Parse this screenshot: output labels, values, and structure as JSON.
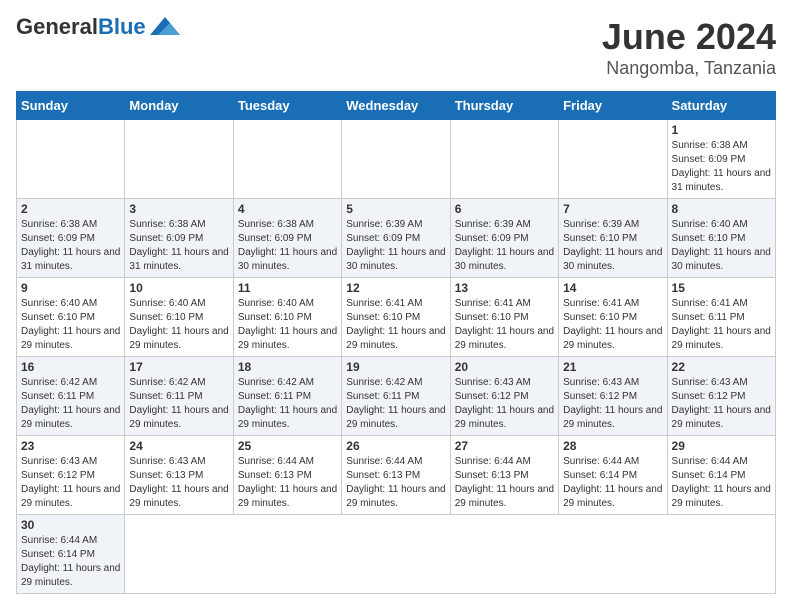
{
  "header": {
    "logo_general": "General",
    "logo_blue": "Blue",
    "month_year": "June 2024",
    "location": "Nangomba, Tanzania"
  },
  "weekdays": [
    "Sunday",
    "Monday",
    "Tuesday",
    "Wednesday",
    "Thursday",
    "Friday",
    "Saturday"
  ],
  "days": [
    {
      "date": null,
      "info": null
    },
    {
      "date": null,
      "info": null
    },
    {
      "date": null,
      "info": null
    },
    {
      "date": null,
      "info": null
    },
    {
      "date": null,
      "info": null
    },
    {
      "date": null,
      "info": null
    },
    {
      "date": "1",
      "sunrise": "6:38 AM",
      "sunset": "6:09 PM",
      "daylight": "11 hours and 31 minutes."
    },
    {
      "date": "2",
      "sunrise": "6:38 AM",
      "sunset": "6:09 PM",
      "daylight": "11 hours and 31 minutes."
    },
    {
      "date": "3",
      "sunrise": "6:38 AM",
      "sunset": "6:09 PM",
      "daylight": "11 hours and 31 minutes."
    },
    {
      "date": "4",
      "sunrise": "6:38 AM",
      "sunset": "6:09 PM",
      "daylight": "11 hours and 30 minutes."
    },
    {
      "date": "5",
      "sunrise": "6:39 AM",
      "sunset": "6:09 PM",
      "daylight": "11 hours and 30 minutes."
    },
    {
      "date": "6",
      "sunrise": "6:39 AM",
      "sunset": "6:09 PM",
      "daylight": "11 hours and 30 minutes."
    },
    {
      "date": "7",
      "sunrise": "6:39 AM",
      "sunset": "6:10 PM",
      "daylight": "11 hours and 30 minutes."
    },
    {
      "date": "8",
      "sunrise": "6:40 AM",
      "sunset": "6:10 PM",
      "daylight": "11 hours and 30 minutes."
    },
    {
      "date": "9",
      "sunrise": "6:40 AM",
      "sunset": "6:10 PM",
      "daylight": "11 hours and 29 minutes."
    },
    {
      "date": "10",
      "sunrise": "6:40 AM",
      "sunset": "6:10 PM",
      "daylight": "11 hours and 29 minutes."
    },
    {
      "date": "11",
      "sunrise": "6:40 AM",
      "sunset": "6:10 PM",
      "daylight": "11 hours and 29 minutes."
    },
    {
      "date": "12",
      "sunrise": "6:41 AM",
      "sunset": "6:10 PM",
      "daylight": "11 hours and 29 minutes."
    },
    {
      "date": "13",
      "sunrise": "6:41 AM",
      "sunset": "6:10 PM",
      "daylight": "11 hours and 29 minutes."
    },
    {
      "date": "14",
      "sunrise": "6:41 AM",
      "sunset": "6:10 PM",
      "daylight": "11 hours and 29 minutes."
    },
    {
      "date": "15",
      "sunrise": "6:41 AM",
      "sunset": "6:11 PM",
      "daylight": "11 hours and 29 minutes."
    },
    {
      "date": "16",
      "sunrise": "6:42 AM",
      "sunset": "6:11 PM",
      "daylight": "11 hours and 29 minutes."
    },
    {
      "date": "17",
      "sunrise": "6:42 AM",
      "sunset": "6:11 PM",
      "daylight": "11 hours and 29 minutes."
    },
    {
      "date": "18",
      "sunrise": "6:42 AM",
      "sunset": "6:11 PM",
      "daylight": "11 hours and 29 minutes."
    },
    {
      "date": "19",
      "sunrise": "6:42 AM",
      "sunset": "6:11 PM",
      "daylight": "11 hours and 29 minutes."
    },
    {
      "date": "20",
      "sunrise": "6:43 AM",
      "sunset": "6:12 PM",
      "daylight": "11 hours and 29 minutes."
    },
    {
      "date": "21",
      "sunrise": "6:43 AM",
      "sunset": "6:12 PM",
      "daylight": "11 hours and 29 minutes."
    },
    {
      "date": "22",
      "sunrise": "6:43 AM",
      "sunset": "6:12 PM",
      "daylight": "11 hours and 29 minutes."
    },
    {
      "date": "23",
      "sunrise": "6:43 AM",
      "sunset": "6:12 PM",
      "daylight": "11 hours and 29 minutes."
    },
    {
      "date": "24",
      "sunrise": "6:43 AM",
      "sunset": "6:13 PM",
      "daylight": "11 hours and 29 minutes."
    },
    {
      "date": "25",
      "sunrise": "6:44 AM",
      "sunset": "6:13 PM",
      "daylight": "11 hours and 29 minutes."
    },
    {
      "date": "26",
      "sunrise": "6:44 AM",
      "sunset": "6:13 PM",
      "daylight": "11 hours and 29 minutes."
    },
    {
      "date": "27",
      "sunrise": "6:44 AM",
      "sunset": "6:13 PM",
      "daylight": "11 hours and 29 minutes."
    },
    {
      "date": "28",
      "sunrise": "6:44 AM",
      "sunset": "6:14 PM",
      "daylight": "11 hours and 29 minutes."
    },
    {
      "date": "29",
      "sunrise": "6:44 AM",
      "sunset": "6:14 PM",
      "daylight": "11 hours and 29 minutes."
    },
    {
      "date": "30",
      "sunrise": "6:44 AM",
      "sunset": "6:14 PM",
      "daylight": "11 hours and 29 minutes."
    }
  ],
  "labels": {
    "sunrise": "Sunrise:",
    "sunset": "Sunset:",
    "daylight": "Daylight:"
  }
}
